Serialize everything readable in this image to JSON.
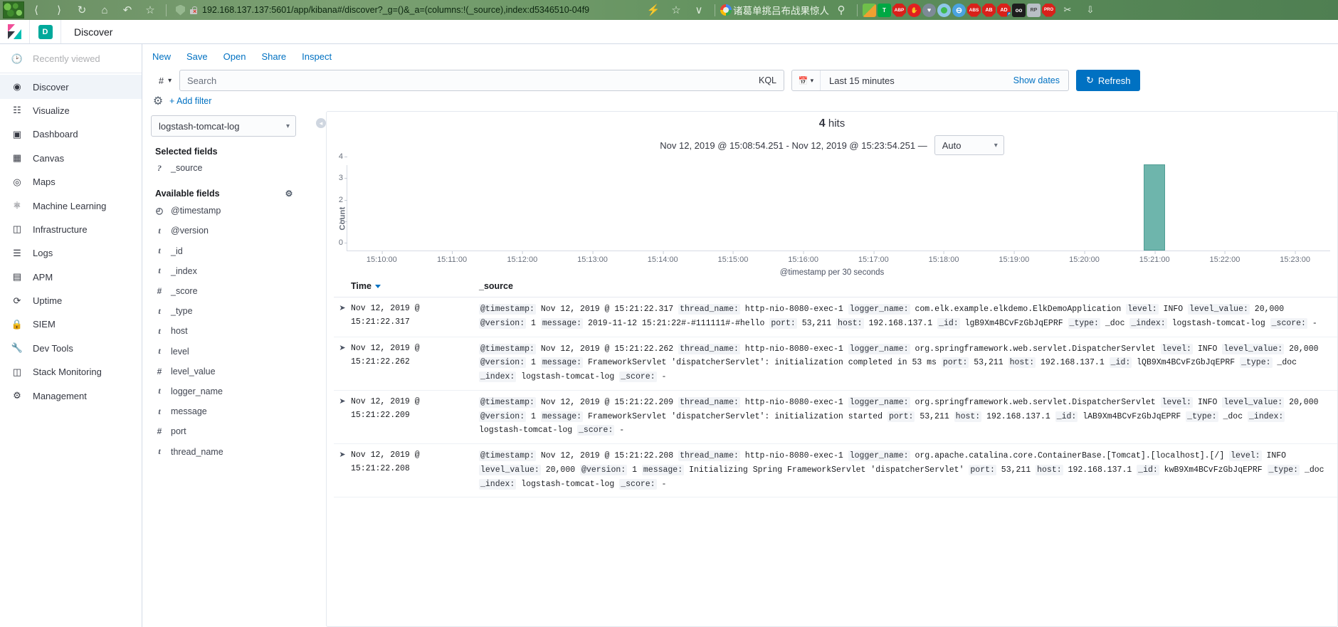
{
  "browser": {
    "nav_icons": [
      "back-arrow",
      "forward-arrow",
      "reload",
      "home",
      "history",
      "bookmark-star"
    ],
    "url": "192.168.137.137:5601/app/kibana#/discover?_g=()&_a=(columns:!(_source),index:d5346510-04f9",
    "lightning_label": "⚡",
    "star_label": "☆",
    "chevron_label": "∨",
    "search_title": "诸葛单挑吕布战果惊人",
    "search_icon": "search-icon",
    "extensions": [
      {
        "name": "apps-grid-icon",
        "label": ""
      },
      {
        "name": "tampermonkey-icon",
        "label": "T"
      },
      {
        "name": "adblock-plus-icon",
        "label": "ABP"
      },
      {
        "name": "stop-hand-icon",
        "label": ""
      },
      {
        "name": "shield-heart-icon",
        "label": ""
      },
      {
        "name": "green-dot-icon",
        "label": ""
      },
      {
        "name": "minus-circle-icon",
        "label": ""
      },
      {
        "name": "abs-blocker-icon",
        "label": "ABS"
      },
      {
        "name": "ab-blocker-icon",
        "label": "AB"
      },
      {
        "name": "ad-counter-icon",
        "label": "AD",
        "badge": "0"
      },
      {
        "name": "goggles-icon",
        "label": "oo"
      },
      {
        "name": "rp-icon",
        "label": "RP"
      },
      {
        "name": "pro-blocker-icon",
        "label": "PRO"
      },
      {
        "name": "scissors-icon",
        "label": ""
      },
      {
        "name": "download-icon",
        "label": ""
      }
    ]
  },
  "kibana": {
    "space_badge": "D",
    "app_title": "Discover",
    "logo_name": "kibana-logo"
  },
  "sidebar": {
    "recently_viewed": "Recently viewed",
    "items": [
      {
        "label": "Discover",
        "icon": "compass-icon",
        "active": true
      },
      {
        "label": "Visualize",
        "icon": "bar-chart-icon",
        "active": false
      },
      {
        "label": "Dashboard",
        "icon": "dashboard-icon",
        "active": false
      },
      {
        "label": "Canvas",
        "icon": "canvas-icon",
        "active": false
      },
      {
        "label": "Maps",
        "icon": "map-pin-icon",
        "active": false
      },
      {
        "label": "Machine Learning",
        "icon": "ml-nodes-icon",
        "active": false
      },
      {
        "label": "Infrastructure",
        "icon": "server-icon",
        "active": false
      },
      {
        "label": "Logs",
        "icon": "logs-icon",
        "active": false
      },
      {
        "label": "APM",
        "icon": "apm-icon",
        "active": false
      },
      {
        "label": "Uptime",
        "icon": "uptime-icon",
        "active": false
      },
      {
        "label": "SIEM",
        "icon": "lock-icon",
        "active": false
      },
      {
        "label": "Dev Tools",
        "icon": "wrench-icon",
        "active": false
      },
      {
        "label": "Stack Monitoring",
        "icon": "monitor-icon",
        "active": false
      },
      {
        "label": "Management",
        "icon": "gear-icon",
        "active": false
      }
    ]
  },
  "top_actions": [
    "New",
    "Save",
    "Open",
    "Share",
    "Inspect"
  ],
  "query_bar": {
    "prefix_icon": "hash-icon",
    "search_placeholder": "Search",
    "search_value": "",
    "language": "KQL",
    "calendar_icon": "calendar-icon",
    "date_range": "Last 15 minutes",
    "show_dates": "Show dates",
    "refresh_label": "Refresh",
    "refresh_icon": "refresh-icon",
    "refresh_color": "#0071c2"
  },
  "filter_bar": {
    "gear_icon": "gear-icon",
    "add_filter": "+ Add filter"
  },
  "field_panel": {
    "index_pattern": "logstash-tomcat-log",
    "selected_fields_title": "Selected fields",
    "available_fields_title": "Available fields",
    "settings_icon": "gear-icon",
    "selected_fields": [
      {
        "name": "_source",
        "type": "?"
      }
    ],
    "available_fields": [
      {
        "name": "@timestamp",
        "type": "◴"
      },
      {
        "name": "@version",
        "type": "t"
      },
      {
        "name": "_id",
        "type": "t"
      },
      {
        "name": "_index",
        "type": "t"
      },
      {
        "name": "_score",
        "type": "#"
      },
      {
        "name": "_type",
        "type": "t"
      },
      {
        "name": "host",
        "type": "t"
      },
      {
        "name": "level",
        "type": "t"
      },
      {
        "name": "level_value",
        "type": "#"
      },
      {
        "name": "logger_name",
        "type": "t"
      },
      {
        "name": "message",
        "type": "t"
      },
      {
        "name": "port",
        "type": "#"
      },
      {
        "name": "thread_name",
        "type": "t"
      }
    ]
  },
  "results": {
    "hits_count": "4",
    "hits_label": "hits",
    "time_range_text": "Nov 12, 2019 @ 15:08:54.251 - Nov 12, 2019 @ 15:23:54.251 —",
    "interval": "Auto"
  },
  "chart_data": {
    "type": "bar",
    "title": "",
    "xlabel": "@timestamp per 30 seconds",
    "ylabel": "Count",
    "ylim": [
      0,
      4
    ],
    "yticks": [
      0,
      1,
      2,
      3,
      4
    ],
    "categories": [
      "15:10:00",
      "15:11:00",
      "15:12:00",
      "15:13:00",
      "15:14:00",
      "15:15:00",
      "15:16:00",
      "15:17:00",
      "15:18:00",
      "15:19:00",
      "15:20:00",
      "15:21:00",
      "15:22:00",
      "15:23:00"
    ],
    "values": [
      0,
      0,
      0,
      0,
      0,
      0,
      0,
      0,
      0,
      0,
      0,
      4,
      0,
      0
    ],
    "bar_color": "#6eb5ac",
    "bar_at": "15:21:00",
    "bar_value": 4,
    "grid": false,
    "legend": "none"
  },
  "table": {
    "columns": [
      "Time",
      "_source"
    ],
    "sort_icon": "caret-down-icon",
    "expand_icon": "expand-arrow-icon",
    "rows": [
      {
        "time": "Nov 12, 2019 @ 15:21:22.317",
        "pairs": [
          {
            "k": "@timestamp:",
            "v": "Nov 12, 2019 @ 15:21:22.317"
          },
          {
            "k": "thread_name:",
            "v": "http-nio-8080-exec-1"
          },
          {
            "k": "logger_name:",
            "v": "com.elk.example.elkdemo.ElkDemoApplication"
          },
          {
            "k": "level:",
            "v": "INFO"
          },
          {
            "k": "level_value:",
            "v": "20,000"
          },
          {
            "k": "@version:",
            "v": "1"
          },
          {
            "k": "message:",
            "v": "2019-11-12 15:21:22#-#111111#-#hello"
          },
          {
            "k": "port:",
            "v": "53,211"
          },
          {
            "k": "host:",
            "v": "192.168.137.1"
          },
          {
            "k": "_id:",
            "v": "lgB9Xm4BCvFzGbJqEPRF"
          },
          {
            "k": "_type:",
            "v": "_doc"
          },
          {
            "k": "_index:",
            "v": "logstash-tomcat-log"
          },
          {
            "k": "_score:",
            "v": "-"
          }
        ]
      },
      {
        "time": "Nov 12, 2019 @ 15:21:22.262",
        "pairs": [
          {
            "k": "@timestamp:",
            "v": "Nov 12, 2019 @ 15:21:22.262"
          },
          {
            "k": "thread_name:",
            "v": "http-nio-8080-exec-1"
          },
          {
            "k": "logger_name:",
            "v": "org.springframework.web.servlet.DispatcherServlet"
          },
          {
            "k": "level:",
            "v": "INFO"
          },
          {
            "k": "level_value:",
            "v": "20,000"
          },
          {
            "k": "@version:",
            "v": "1"
          },
          {
            "k": "message:",
            "v": "FrameworkServlet 'dispatcherServlet': initialization completed in 53 ms"
          },
          {
            "k": "port:",
            "v": "53,211"
          },
          {
            "k": "host:",
            "v": "192.168.137.1"
          },
          {
            "k": "_id:",
            "v": "lQB9Xm4BCvFzGbJqEPRF"
          },
          {
            "k": "_type:",
            "v": "_doc"
          },
          {
            "k": "_index:",
            "v": "logstash-tomcat-log"
          },
          {
            "k": "_score:",
            "v": "-"
          }
        ]
      },
      {
        "time": "Nov 12, 2019 @ 15:21:22.209",
        "pairs": [
          {
            "k": "@timestamp:",
            "v": "Nov 12, 2019 @ 15:21:22.209"
          },
          {
            "k": "thread_name:",
            "v": "http-nio-8080-exec-1"
          },
          {
            "k": "logger_name:",
            "v": "org.springframework.web.servlet.DispatcherServlet"
          },
          {
            "k": "level:",
            "v": "INFO"
          },
          {
            "k": "level_value:",
            "v": "20,000"
          },
          {
            "k": "@version:",
            "v": "1"
          },
          {
            "k": "message:",
            "v": "FrameworkServlet 'dispatcherServlet': initialization started"
          },
          {
            "k": "port:",
            "v": "53,211"
          },
          {
            "k": "host:",
            "v": "192.168.137.1"
          },
          {
            "k": "_id:",
            "v": "lAB9Xm4BCvFzGbJqEPRF"
          },
          {
            "k": "_type:",
            "v": "_doc"
          },
          {
            "k": "_index:",
            "v": "logstash-tomcat-log"
          },
          {
            "k": "_score:",
            "v": "-"
          }
        ]
      },
      {
        "time": "Nov 12, 2019 @ 15:21:22.208",
        "pairs": [
          {
            "k": "@timestamp:",
            "v": "Nov 12, 2019 @ 15:21:22.208"
          },
          {
            "k": "thread_name:",
            "v": "http-nio-8080-exec-1"
          },
          {
            "k": "logger_name:",
            "v": "org.apache.catalina.core.ContainerBase.[Tomcat].[localhost].[/]"
          },
          {
            "k": "level:",
            "v": "INFO"
          },
          {
            "k": "level_value:",
            "v": "20,000"
          },
          {
            "k": "@version:",
            "v": "1"
          },
          {
            "k": "message:",
            "v": "Initializing Spring FrameworkServlet 'dispatcherServlet'"
          },
          {
            "k": "port:",
            "v": "53,211"
          },
          {
            "k": "host:",
            "v": "192.168.137.1"
          },
          {
            "k": "_id:",
            "v": "kwB9Xm4BCvFzGbJqEPRF"
          },
          {
            "k": "_type:",
            "v": "_doc"
          },
          {
            "k": "_index:",
            "v": "logstash-tomcat-log"
          },
          {
            "k": "_score:",
            "v": "-"
          }
        ]
      }
    ]
  }
}
